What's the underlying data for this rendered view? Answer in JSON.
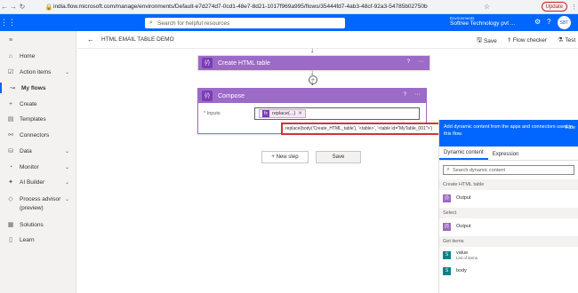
{
  "browser": {
    "url": "india.flow.microsoft.com/manage/environments/Default-e7d274d7-0cd1-48e7-8d21-1017f969a995/flows/35444fd7-4ab3-48cf-92a3-54785b02750b",
    "update_label": "Update"
  },
  "header": {
    "search_placeholder": "Search for helpful resources",
    "environment_label": "Environments",
    "environment_name": "Softree Technology pvt ...",
    "avatar_initials": "SBT"
  },
  "nav": {
    "items": [
      {
        "label": "Home"
      },
      {
        "label": "Action items"
      },
      {
        "label": "My flows"
      },
      {
        "label": "Create"
      },
      {
        "label": "Templates"
      },
      {
        "label": "Connectors"
      },
      {
        "label": "Data"
      },
      {
        "label": "Monitor"
      },
      {
        "label": "AI Builder"
      },
      {
        "label": "Process advisor"
      },
      {
        "label": "(preview)"
      },
      {
        "label": "Solutions"
      },
      {
        "label": "Learn"
      }
    ]
  },
  "cmdbar": {
    "flow_title": "HTML EMAIL TABLE DEMO",
    "save_label": "Save",
    "flow_checker_label": "Flow checker",
    "test_label": "Test"
  },
  "steps": {
    "create_html": "Create HTML table",
    "compose": "Compose",
    "inputs_label": "* Inputs",
    "token_label": "replace(...)",
    "expression": "replace(body('Create_HTML_table'), '<table>', '<table id=\"MyTable_001\">')",
    "new_step": "+ New step",
    "save": "Save"
  },
  "dynamic": {
    "header_text": "Add dynamic content from the apps and connectors used in this flow.",
    "hide_label": "Hide",
    "tab_dynamic": "Dynamic content",
    "tab_expression": "Expression",
    "search_placeholder": "Search dynamic content",
    "sections": [
      {
        "title": "Create HTML table",
        "item": "Output"
      },
      {
        "title": "Select",
        "item": "Output"
      },
      {
        "title": "Get items",
        "items": [
          {
            "label": "value",
            "sub": "List of items"
          },
          {
            "label": "body",
            "sub": ""
          }
        ]
      }
    ]
  },
  "colors": {
    "brand": "#0066ff",
    "compose_purple": "#9c6ac7",
    "highlight_red": "#d13438"
  }
}
